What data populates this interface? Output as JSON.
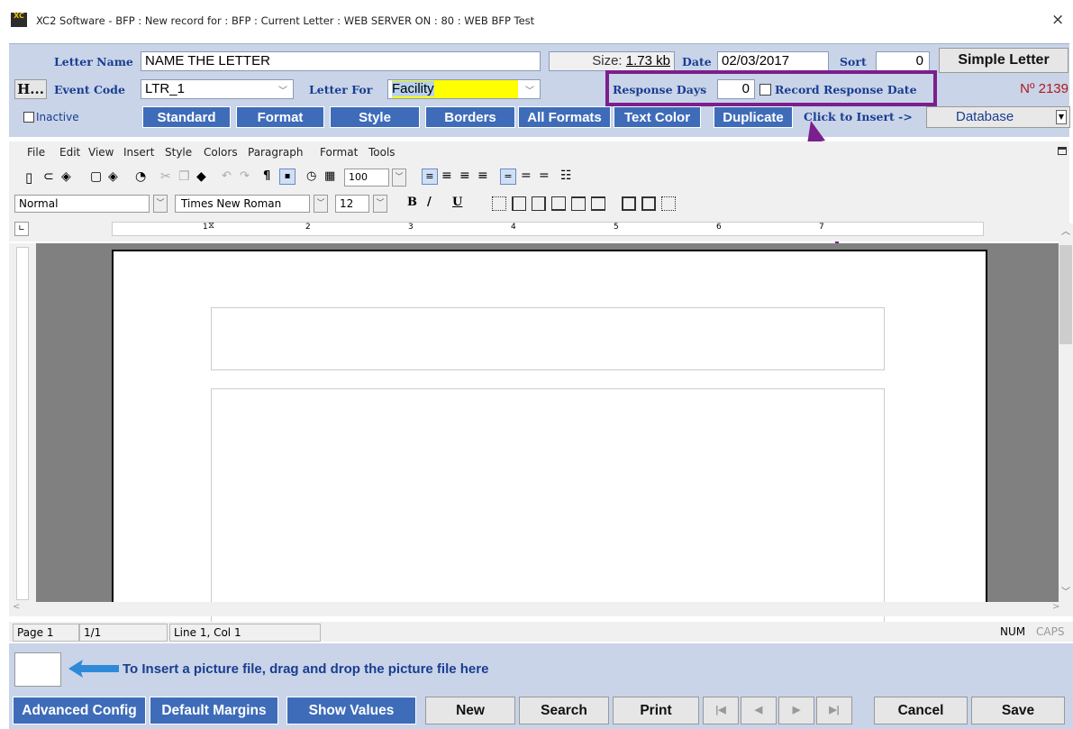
{
  "window": {
    "title": "XC2 Software - BFP : New record for : BFP : Current Letter : WEB SERVER ON : 80 : WEB BFP Test",
    "app_icon": "XC",
    "close_label": "×"
  },
  "header": {
    "letter_name_label": "Letter Name",
    "letter_name_value": "NAME THE LETTER",
    "size_label": "Size:",
    "size_value": "1.73 kb",
    "date_label": "Date",
    "date_value": "02/03/2017",
    "sort_label": "Sort",
    "sort_value": "0",
    "simple_letter_label": "Simple Letter",
    "h_button_label": "H...",
    "event_code_label": "Event Code",
    "event_code_value": "LTR_1",
    "letter_for_label": "Letter For",
    "letter_for_value": "Facility",
    "response_days_label": "Response Days",
    "response_days_value": "0",
    "record_response_label": "Record Response Date",
    "record_number": "Nº 2139",
    "inactive_label": "Inactive",
    "click_insert_label": "Click to Insert ->",
    "database_value": "Database"
  },
  "format_buttons": [
    "Standard",
    "Format",
    "Style",
    "Borders",
    "All Formats",
    "Text Color",
    "Duplicate"
  ],
  "menu": [
    "File",
    "Edit",
    "View",
    "Insert",
    "Style",
    "Colors",
    "Paragraph",
    "Format",
    "Tools"
  ],
  "toolbar": {
    "zoom_value": "100",
    "style_value": "Normal",
    "font_value": "Times New Roman",
    "size_value": "12",
    "bold": "B",
    "italic": "/",
    "underline": "U",
    "pilcrow": "¶"
  },
  "ruler": {
    "marks": [
      "1",
      "2",
      "3",
      "4",
      "5",
      "6",
      "7"
    ]
  },
  "status": {
    "page": "Page 1",
    "count": "1/1",
    "position": "Line 1, Col 1",
    "num": "NUM",
    "caps": "CAPS"
  },
  "dropzone": {
    "text": "To Insert a picture file, drag and drop the picture file here"
  },
  "bottom": {
    "advanced_config": "Advanced Config",
    "default_margins": "Default Margins",
    "show_values": "Show Values",
    "new": "New",
    "search": "Search",
    "print": "Print",
    "cancel": "Cancel",
    "save": "Save"
  },
  "colors": {
    "accent": "#3e6cb9",
    "panel": "#c9d4e8",
    "highlight_box": "#7b1f8c",
    "yellow": "#ffff00"
  }
}
